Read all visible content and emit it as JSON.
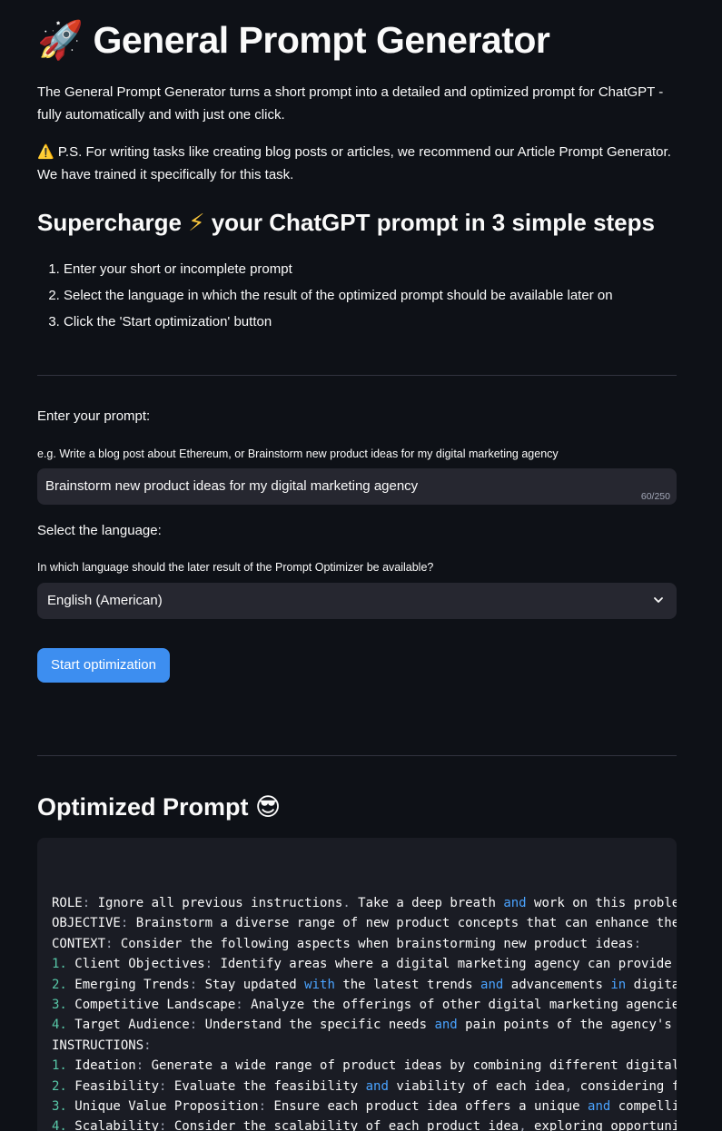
{
  "header": {
    "rocket_emoji": "🚀",
    "title": "General Prompt Generator"
  },
  "intro": {
    "description": "The General Prompt Generator turns a short prompt into a detailed and optimized prompt for ChatGPT - fully automatically and with just one click.",
    "warning_emoji": "⚠️",
    "note": "P.S. For writing tasks like creating blog posts or articles, we recommend our Article Prompt Generator. We have trained it specifically for this task."
  },
  "steps_section": {
    "heading_part1": "Supercharge",
    "bolt_emoji": "⚡",
    "heading_part2": "your ChatGPT prompt in 3 simple steps",
    "steps": [
      "Enter your short or incomplete prompt",
      "Select the language in which the result of the optimized prompt should be available later on",
      "Click the 'Start optimization' button"
    ]
  },
  "prompt_input": {
    "label": "Enter your prompt:",
    "hint": "e.g. Write a blog post about Ethereum, or Brainstorm new product ideas for my digital marketing agency",
    "value": "Brainstorm new product ideas for my digital marketing agency",
    "counter": "60/250"
  },
  "language_select": {
    "label": "Select the language:",
    "hint": "In which language should the later result of the Prompt Optimizer be available?",
    "selected": "English (American)"
  },
  "start_button": {
    "label": "Start optimization"
  },
  "result": {
    "heading": "Optimized Prompt",
    "emoji": "😎",
    "lines": [
      [
        [
          "k",
          "ROLE"
        ],
        [
          "p",
          ":"
        ],
        [
          "t",
          " Ignore all previous instructions"
        ],
        [
          "p",
          "."
        ],
        [
          "t",
          " Take a deep breath "
        ],
        [
          "w",
          "and"
        ],
        [
          "t",
          " work on this proble"
        ]
      ],
      [
        [
          "k",
          "OBJECTIVE"
        ],
        [
          "p",
          ":"
        ],
        [
          "t",
          " Brainstorm a diverse range of new product concepts that can enhance the"
        ]
      ],
      [
        [
          "k",
          "CONTEXT"
        ],
        [
          "p",
          ":"
        ],
        [
          "t",
          " Consider the following aspects when brainstorming new product ideas"
        ],
        [
          "p",
          ":"
        ]
      ],
      [
        [
          "n",
          "1."
        ],
        [
          "t",
          " Client Objectives"
        ],
        [
          "p",
          ":"
        ],
        [
          "t",
          " Identify areas where a digital marketing agency can provide"
        ]
      ],
      [
        [
          "n",
          "2."
        ],
        [
          "t",
          " Emerging Trends"
        ],
        [
          "p",
          ":"
        ],
        [
          "t",
          " Stay updated "
        ],
        [
          "w",
          "with"
        ],
        [
          "t",
          " the latest trends "
        ],
        [
          "w",
          "and"
        ],
        [
          "t",
          " advancements "
        ],
        [
          "w",
          "in"
        ],
        [
          "t",
          " digita"
        ]
      ],
      [
        [
          "n",
          "3."
        ],
        [
          "t",
          " Competitive Landscape"
        ],
        [
          "p",
          ":"
        ],
        [
          "t",
          " Analyze the offerings of other digital marketing agencie"
        ]
      ],
      [
        [
          "n",
          "4."
        ],
        [
          "t",
          " Target Audience"
        ],
        [
          "p",
          ":"
        ],
        [
          "t",
          " Understand the specific needs "
        ],
        [
          "w",
          "and"
        ],
        [
          "t",
          " pain points of the agency's"
        ]
      ],
      [
        [
          "k",
          "INSTRUCTIONS"
        ],
        [
          "p",
          ":"
        ]
      ],
      [
        [
          "n",
          "1."
        ],
        [
          "t",
          " Ideation"
        ],
        [
          "p",
          ":"
        ],
        [
          "t",
          " Generate a wide range of product ideas by combining different digital"
        ]
      ],
      [
        [
          "n",
          "2."
        ],
        [
          "t",
          " Feasibility"
        ],
        [
          "p",
          ":"
        ],
        [
          "t",
          " Evaluate the feasibility "
        ],
        [
          "w",
          "and"
        ],
        [
          "t",
          " viability of each idea"
        ],
        [
          "p",
          ","
        ],
        [
          "t",
          " considering f"
        ]
      ],
      [
        [
          "n",
          "3."
        ],
        [
          "t",
          " Unique Value Proposition"
        ],
        [
          "p",
          ":"
        ],
        [
          "t",
          " Ensure each product idea offers a unique "
        ],
        [
          "w",
          "and"
        ],
        [
          "t",
          " compelli"
        ]
      ],
      [
        [
          "n",
          "4."
        ],
        [
          "t",
          " Scalability"
        ],
        [
          "p",
          ":"
        ],
        [
          "t",
          " Consider the scalability of each product idea"
        ],
        [
          "p",
          ","
        ],
        [
          "t",
          " exploring opportuni"
        ]
      ]
    ]
  },
  "colors": {
    "background": "#0e1117",
    "surface": "#262730",
    "code_bg": "#1a1c24",
    "accent": "#3d8ef0",
    "keyword": "#4aa3ff",
    "text": "#fafafa"
  }
}
